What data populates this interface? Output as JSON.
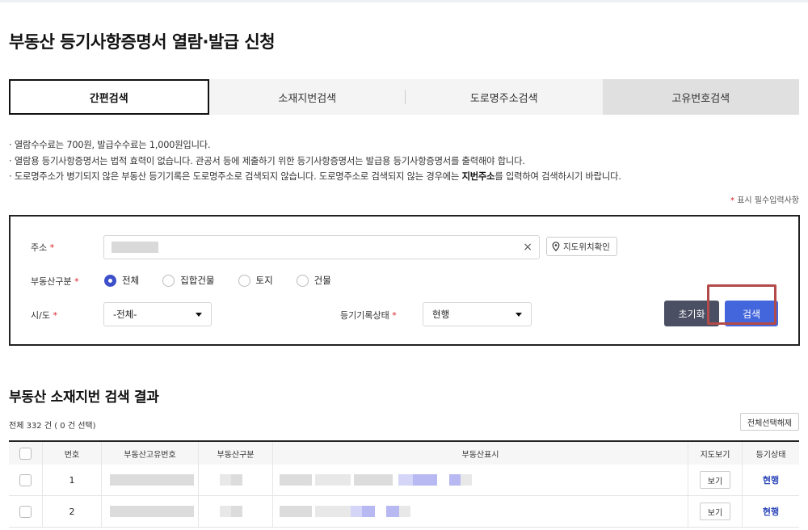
{
  "page": {
    "title": "부동산 등기사항증명서 열람·발급 신청"
  },
  "tabs": [
    {
      "label": "간편검색",
      "active": true
    },
    {
      "label": "소재지번검색",
      "active": false
    },
    {
      "label": "도로명주소검색",
      "active": false
    },
    {
      "label": "고유번호검색",
      "active": false
    }
  ],
  "notices": {
    "line1": "열람수수료는  700원, 발급수수료는  1,000원입니다.",
    "line2": "열람용 등기사항증명서는 법적 효력이 없습니다. 관공서 등에 제출하기 위한 등기사항증명서는 발급용 등기사항증명서를 출력해야 합니다.",
    "line3_a": "도로명주소가 병기되지 않은 부동산 등기기록은 도로명주소로 검색되지 않습니다. 도로명주소로 검색되지 않는 경우에는 ",
    "line3_b": "지번주소",
    "line3_c": "를 입력하여 검색하시기 바랍니다.",
    "bullet": "·"
  },
  "required_note": {
    "star": "*",
    "text": " 표시 필수입력사항"
  },
  "form": {
    "required_mark": "*",
    "address_label": "주소",
    "clear_symbol": "×",
    "map_button": "지도위치확인",
    "property_type_label": "부동산구분",
    "property_types": [
      "전체",
      "집합건물",
      "토지",
      "건물"
    ],
    "property_type_selected": "전체",
    "sido_label": "시/도",
    "sido_value": "-전체-",
    "record_status_label": "등기기록상태",
    "record_status_value": "현행",
    "reset_button": "초기화",
    "search_button": "검색"
  },
  "results": {
    "title": "부동산 소재지번 검색 결과",
    "count_text": "전체 332 건 ( 0 건 선택)",
    "deselect_button": "전체선택해제",
    "columns": [
      "",
      "번호",
      "부동산고유번호",
      "부동산구분",
      "부동산표시",
      "지도보기",
      "등기상태"
    ],
    "rows": [
      {
        "no": "1",
        "map_button": "보기",
        "status": "현행"
      },
      {
        "no": "2",
        "map_button": "보기",
        "status": "현행"
      }
    ]
  },
  "colors": {
    "primary": "#4466dd",
    "dark": "#4a4f63",
    "status": "#2c46b8",
    "highlight": "#b24a4a",
    "required": "#d8232a"
  }
}
